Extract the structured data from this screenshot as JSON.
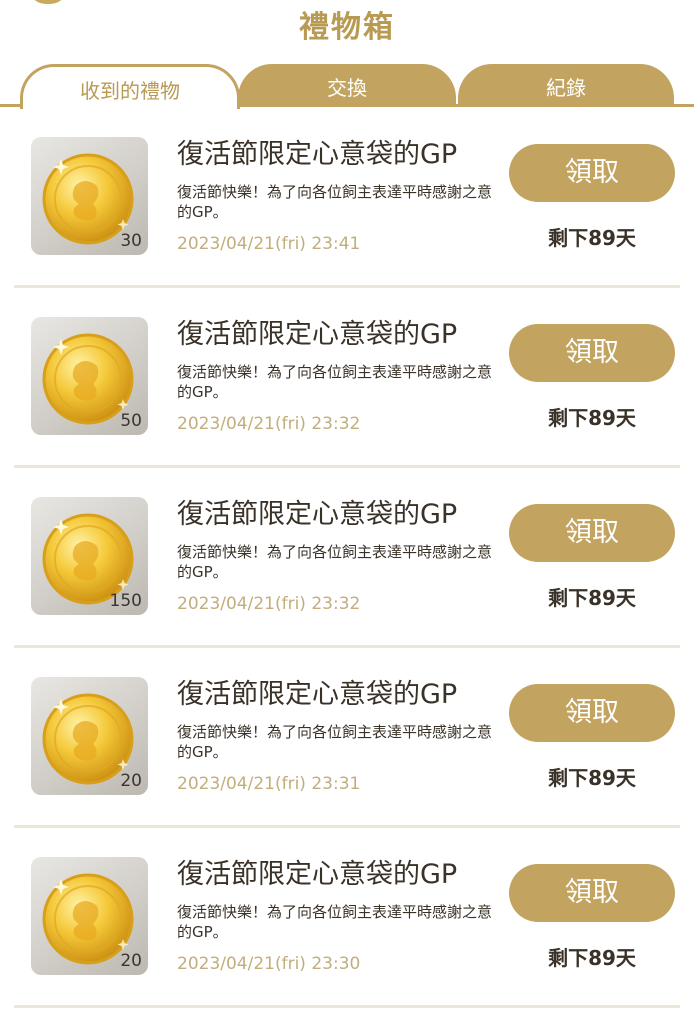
{
  "header": {
    "title": "禮物箱"
  },
  "tabs": [
    {
      "label": "收到的禮物"
    },
    {
      "label": "交換"
    },
    {
      "label": "紀錄"
    }
  ],
  "colors": {
    "accent": "#c2a460",
    "date_text": "#c2ad7c",
    "title_text": "#b89a52"
  },
  "gifts": [
    {
      "title": "復活節限定心意袋的GP",
      "description": "復活節快樂！為了向各位飼主表達平時感謝之意的GP。",
      "date": "2023/04/21(fri) 23:41",
      "amount": "30",
      "claim_label": "領取",
      "remaining": "剩下89天",
      "icon": "gold-coin-icon"
    },
    {
      "title": "復活節限定心意袋的GP",
      "description": "復活節快樂！為了向各位飼主表達平時感謝之意的GP。",
      "date": "2023/04/21(fri) 23:32",
      "amount": "50",
      "claim_label": "領取",
      "remaining": "剩下89天",
      "icon": "gold-coin-icon"
    },
    {
      "title": "復活節限定心意袋的GP",
      "description": "復活節快樂！為了向各位飼主表達平時感謝之意的GP。",
      "date": "2023/04/21(fri) 23:32",
      "amount": "150",
      "claim_label": "領取",
      "remaining": "剩下89天",
      "icon": "gold-coin-icon"
    },
    {
      "title": "復活節限定心意袋的GP",
      "description": "復活節快樂！為了向各位飼主表達平時感謝之意的GP。",
      "date": "2023/04/21(fri) 23:31",
      "amount": "20",
      "claim_label": "領取",
      "remaining": "剩下89天",
      "icon": "gold-coin-icon"
    },
    {
      "title": "復活節限定心意袋的GP",
      "description": "復活節快樂！為了向各位飼主表達平時感謝之意的GP。",
      "date": "2023/04/21(fri) 23:30",
      "amount": "20",
      "claim_label": "領取",
      "remaining": "剩下89天",
      "icon": "gold-coin-icon"
    }
  ]
}
